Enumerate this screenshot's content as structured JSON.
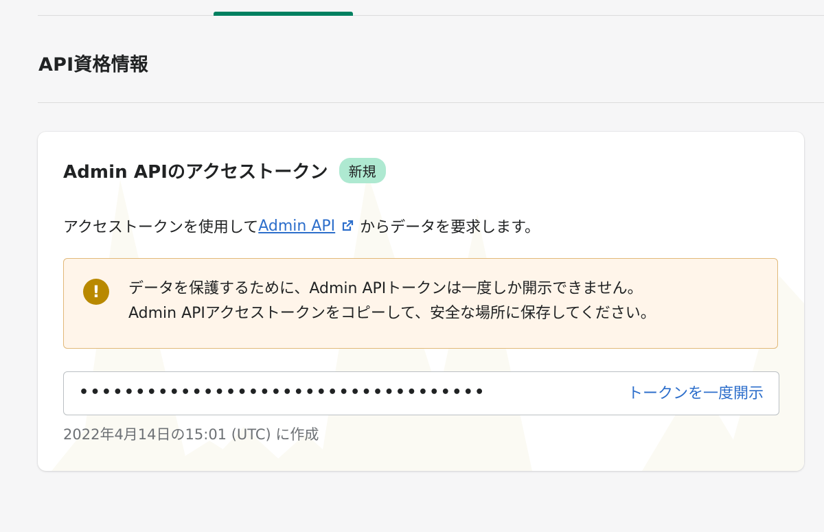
{
  "section": {
    "title": "API資格情報"
  },
  "card": {
    "title": "Admin APIのアクセストークン",
    "badge": "新規",
    "description_prefix": "アクセストークンを使用して",
    "description_link": "Admin API",
    "description_suffix": "からデータを要求します。"
  },
  "banner": {
    "icon": "exclamation-circle-icon",
    "line1": "データを保護するために、Admin APIトークンは一度しか開示できません。",
    "line2": "Admin APIアクセストークンをコピーして、安全な場所に保存してください。"
  },
  "token": {
    "masked_value": "••••••••••••••••••••••••••••••••••••",
    "reveal_label": "トークンを一度開示"
  },
  "created": {
    "text": "2022年4月14日の15:01 (UTC) に作成"
  },
  "colors": {
    "accent_tab": "#008060",
    "link": "#2c6ecb",
    "badge_bg": "#aee9d1",
    "banner_bg": "#fff5ea",
    "banner_border": "#e1b878",
    "warning_icon": "#b98900"
  }
}
